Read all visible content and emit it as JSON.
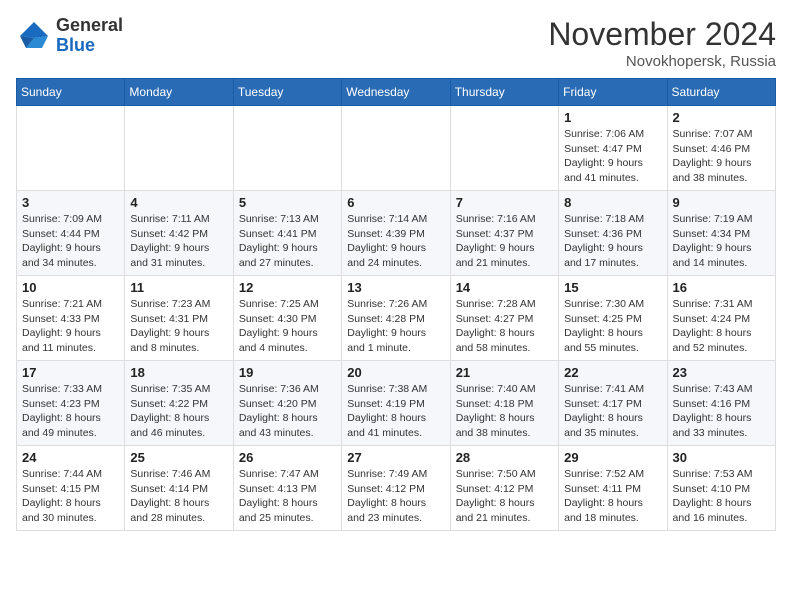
{
  "header": {
    "logo_general": "General",
    "logo_blue": "Blue",
    "month_title": "November 2024",
    "location": "Novokhopersk, Russia"
  },
  "days_of_week": [
    "Sunday",
    "Monday",
    "Tuesday",
    "Wednesday",
    "Thursday",
    "Friday",
    "Saturday"
  ],
  "weeks": [
    [
      {
        "day": "",
        "info": ""
      },
      {
        "day": "",
        "info": ""
      },
      {
        "day": "",
        "info": ""
      },
      {
        "day": "",
        "info": ""
      },
      {
        "day": "",
        "info": ""
      },
      {
        "day": "1",
        "info": "Sunrise: 7:06 AM\nSunset: 4:47 PM\nDaylight: 9 hours and 41 minutes."
      },
      {
        "day": "2",
        "info": "Sunrise: 7:07 AM\nSunset: 4:46 PM\nDaylight: 9 hours and 38 minutes."
      }
    ],
    [
      {
        "day": "3",
        "info": "Sunrise: 7:09 AM\nSunset: 4:44 PM\nDaylight: 9 hours and 34 minutes."
      },
      {
        "day": "4",
        "info": "Sunrise: 7:11 AM\nSunset: 4:42 PM\nDaylight: 9 hours and 31 minutes."
      },
      {
        "day": "5",
        "info": "Sunrise: 7:13 AM\nSunset: 4:41 PM\nDaylight: 9 hours and 27 minutes."
      },
      {
        "day": "6",
        "info": "Sunrise: 7:14 AM\nSunset: 4:39 PM\nDaylight: 9 hours and 24 minutes."
      },
      {
        "day": "7",
        "info": "Sunrise: 7:16 AM\nSunset: 4:37 PM\nDaylight: 9 hours and 21 minutes."
      },
      {
        "day": "8",
        "info": "Sunrise: 7:18 AM\nSunset: 4:36 PM\nDaylight: 9 hours and 17 minutes."
      },
      {
        "day": "9",
        "info": "Sunrise: 7:19 AM\nSunset: 4:34 PM\nDaylight: 9 hours and 14 minutes."
      }
    ],
    [
      {
        "day": "10",
        "info": "Sunrise: 7:21 AM\nSunset: 4:33 PM\nDaylight: 9 hours and 11 minutes."
      },
      {
        "day": "11",
        "info": "Sunrise: 7:23 AM\nSunset: 4:31 PM\nDaylight: 9 hours and 8 minutes."
      },
      {
        "day": "12",
        "info": "Sunrise: 7:25 AM\nSunset: 4:30 PM\nDaylight: 9 hours and 4 minutes."
      },
      {
        "day": "13",
        "info": "Sunrise: 7:26 AM\nSunset: 4:28 PM\nDaylight: 9 hours and 1 minute."
      },
      {
        "day": "14",
        "info": "Sunrise: 7:28 AM\nSunset: 4:27 PM\nDaylight: 8 hours and 58 minutes."
      },
      {
        "day": "15",
        "info": "Sunrise: 7:30 AM\nSunset: 4:25 PM\nDaylight: 8 hours and 55 minutes."
      },
      {
        "day": "16",
        "info": "Sunrise: 7:31 AM\nSunset: 4:24 PM\nDaylight: 8 hours and 52 minutes."
      }
    ],
    [
      {
        "day": "17",
        "info": "Sunrise: 7:33 AM\nSunset: 4:23 PM\nDaylight: 8 hours and 49 minutes."
      },
      {
        "day": "18",
        "info": "Sunrise: 7:35 AM\nSunset: 4:22 PM\nDaylight: 8 hours and 46 minutes."
      },
      {
        "day": "19",
        "info": "Sunrise: 7:36 AM\nSunset: 4:20 PM\nDaylight: 8 hours and 43 minutes."
      },
      {
        "day": "20",
        "info": "Sunrise: 7:38 AM\nSunset: 4:19 PM\nDaylight: 8 hours and 41 minutes."
      },
      {
        "day": "21",
        "info": "Sunrise: 7:40 AM\nSunset: 4:18 PM\nDaylight: 8 hours and 38 minutes."
      },
      {
        "day": "22",
        "info": "Sunrise: 7:41 AM\nSunset: 4:17 PM\nDaylight: 8 hours and 35 minutes."
      },
      {
        "day": "23",
        "info": "Sunrise: 7:43 AM\nSunset: 4:16 PM\nDaylight: 8 hours and 33 minutes."
      }
    ],
    [
      {
        "day": "24",
        "info": "Sunrise: 7:44 AM\nSunset: 4:15 PM\nDaylight: 8 hours and 30 minutes."
      },
      {
        "day": "25",
        "info": "Sunrise: 7:46 AM\nSunset: 4:14 PM\nDaylight: 8 hours and 28 minutes."
      },
      {
        "day": "26",
        "info": "Sunrise: 7:47 AM\nSunset: 4:13 PM\nDaylight: 8 hours and 25 minutes."
      },
      {
        "day": "27",
        "info": "Sunrise: 7:49 AM\nSunset: 4:12 PM\nDaylight: 8 hours and 23 minutes."
      },
      {
        "day": "28",
        "info": "Sunrise: 7:50 AM\nSunset: 4:12 PM\nDaylight: 8 hours and 21 minutes."
      },
      {
        "day": "29",
        "info": "Sunrise: 7:52 AM\nSunset: 4:11 PM\nDaylight: 8 hours and 18 minutes."
      },
      {
        "day": "30",
        "info": "Sunrise: 7:53 AM\nSunset: 4:10 PM\nDaylight: 8 hours and 16 minutes."
      }
    ]
  ]
}
